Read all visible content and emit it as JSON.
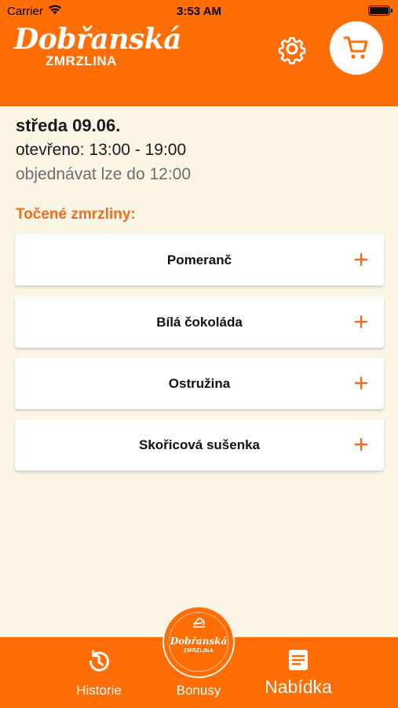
{
  "status_bar": {
    "carrier": "Carrier",
    "time": "3:53 AM"
  },
  "header": {
    "logo_script": "Dobřanská",
    "logo_sub": "ZMRZLINA",
    "settings_icon": "gear-icon",
    "cart_icon": "cart-icon"
  },
  "info": {
    "date": "středa 09.06.",
    "opening_hours": "otevřeno: 13:00 - 19:00",
    "order_deadline": "objednávat lze do 12:00"
  },
  "section": {
    "title": "Točené zmrzliny:"
  },
  "items": [
    {
      "name": "Pomeranč"
    },
    {
      "name": "Bílá čokoláda"
    },
    {
      "name": "Ostružina"
    },
    {
      "name": "Skořicová sušenka"
    }
  ],
  "tabbar": {
    "history": {
      "label": "Historie",
      "icon": "history-icon"
    },
    "bonus": {
      "label": "Bonusy",
      "badge_script": "Dobřanská",
      "badge_sub": "ZMRZLINA"
    },
    "offer": {
      "label": "Nabídka",
      "icon": "menu-list-icon"
    }
  },
  "colors": {
    "brand_orange": "#ff6d05",
    "background": "#fbf5e6",
    "section_title": "#ef6d22",
    "add_icon": "#ef6d22"
  }
}
